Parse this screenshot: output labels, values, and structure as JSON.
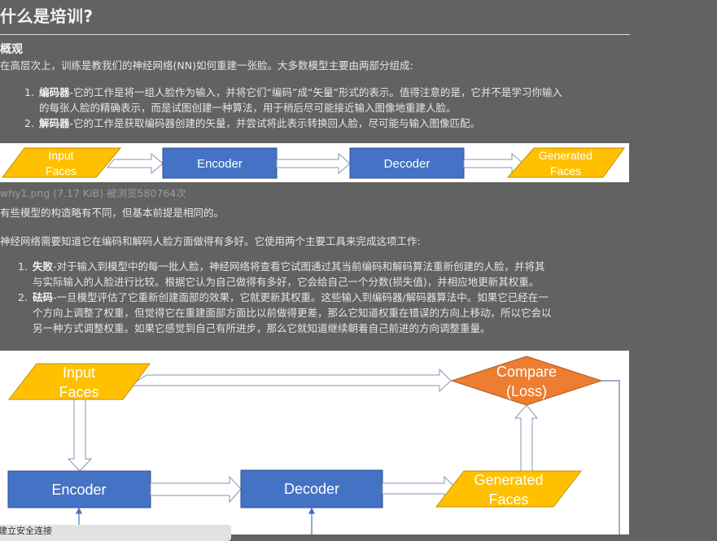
{
  "article": {
    "title": "什么是培训?",
    "section_overview": "概观",
    "intro": "在高层次上，训练是教我们的神经网络(NN)如何重建一张脸。大多数模型主要由两部分组成:",
    "parts_list": [
      {
        "num": "1.",
        "term": "编码器",
        "text_line1": "-它的工作是将一组人脸作为输入，并将它们“编码”成“矢量”形式的表示。值得注意的是，它并不是学习你输入",
        "text_line2": "的每张人脸的精确表示，而是试图创建一种算法，用于稍后尽可能接近输入图像地重建人脸。"
      },
      {
        "num": "2.",
        "term": "解码器",
        "text_line1": "-它的工作是获取编码器创建的矢量，并尝试将此表示转换回人脸，尽可能与输入图像匹配。",
        "text_line2": ""
      }
    ],
    "image_caption": "why1.png (7.17 KiB) 被浏览580764次",
    "para_variation": "有些模型的构造略有不同，但基本前提是相同的。",
    "para_tools": "神经网络需要知道它在编码和解码人脸方面做得有多好。它使用两个主要工具来完成这项工作:",
    "tools_list": [
      {
        "num": "1.",
        "term": "失败",
        "lines": [
          "-对于输入到模型中的每一批人脸，神经网络将查看它试图通过其当前编码和解码算法重新创建的人脸，并将其",
          "与实际输入的人脸进行比较。根据它认为自己做得有多好，它会给自己一个分数(损失值)，并相应地更新其权重。"
        ]
      },
      {
        "num": "2.",
        "term": "砝码",
        "lines": [
          "-一旦模型评估了它重新创建面部的效果，它就更新其权重。这些输入到编码器/解码器算法中。如果它已经在一",
          "个方向上调整了权重，但觉得它在重建面部方面比以前做得更差，那么它知道权重在错误的方向上移动，所以它会以",
          "另一种方式调整权重。如果它感觉到自己有所进步，那么它就知道继续朝着自己前进的方向调整重量。"
        ]
      }
    ]
  },
  "diagram1": {
    "input_label": [
      "Input",
      "Faces"
    ],
    "encoder_label": "Encoder",
    "decoder_label": "Decoder",
    "output_label": [
      "Generated",
      "Faces"
    ]
  },
  "diagram2": {
    "input_label": [
      "Input",
      "Faces"
    ],
    "compare_label": [
      "Compare",
      "(Loss)"
    ],
    "encoder_label": "Encoder",
    "decoder_label": "Decoder",
    "generated_label": [
      "Generated",
      "Faces"
    ]
  },
  "status_tooltip": "建立安全连接",
  "colors": {
    "page_bg": "#626262",
    "yellow": "#ffc000",
    "blue": "#4472c4",
    "orange": "#ed7d31",
    "arrow": "#8497b0"
  }
}
